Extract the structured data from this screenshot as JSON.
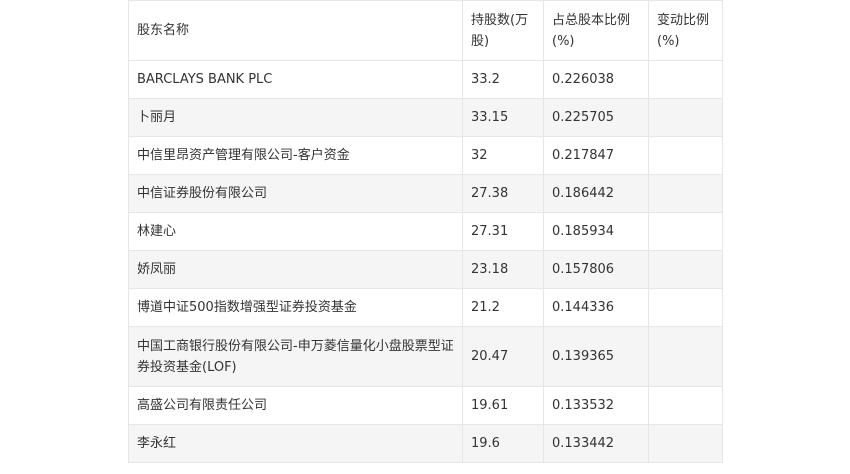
{
  "table": {
    "headers": [
      "股东名称",
      "持股数(万股)",
      "占总股本比例(%)",
      "变动比例(%)"
    ],
    "rows": [
      [
        "BARCLAYS BANK PLC",
        "33.2",
        "0.226038",
        ""
      ],
      [
        "卜丽月",
        "33.15",
        "0.225705",
        ""
      ],
      [
        "中信里昂资产管理有限公司-客户资金",
        "32",
        "0.217847",
        ""
      ],
      [
        "中信证券股份有限公司",
        "27.38",
        "0.186442",
        ""
      ],
      [
        "林建心",
        "27.31",
        "0.185934",
        ""
      ],
      [
        "娇凤丽",
        "23.18",
        "0.157806",
        ""
      ],
      [
        "博道中证500指数增强型证券投资基金",
        "21.2",
        "0.144336",
        ""
      ],
      [
        "中国工商银行股份有限公司-申万菱信量化小盘股票型证券投资基金(LOF)",
        "20.47",
        "0.139365",
        ""
      ],
      [
        "高盛公司有限责任公司",
        "19.61",
        "0.133532",
        ""
      ],
      [
        "李永红",
        "19.6",
        "0.133442",
        ""
      ]
    ]
  }
}
